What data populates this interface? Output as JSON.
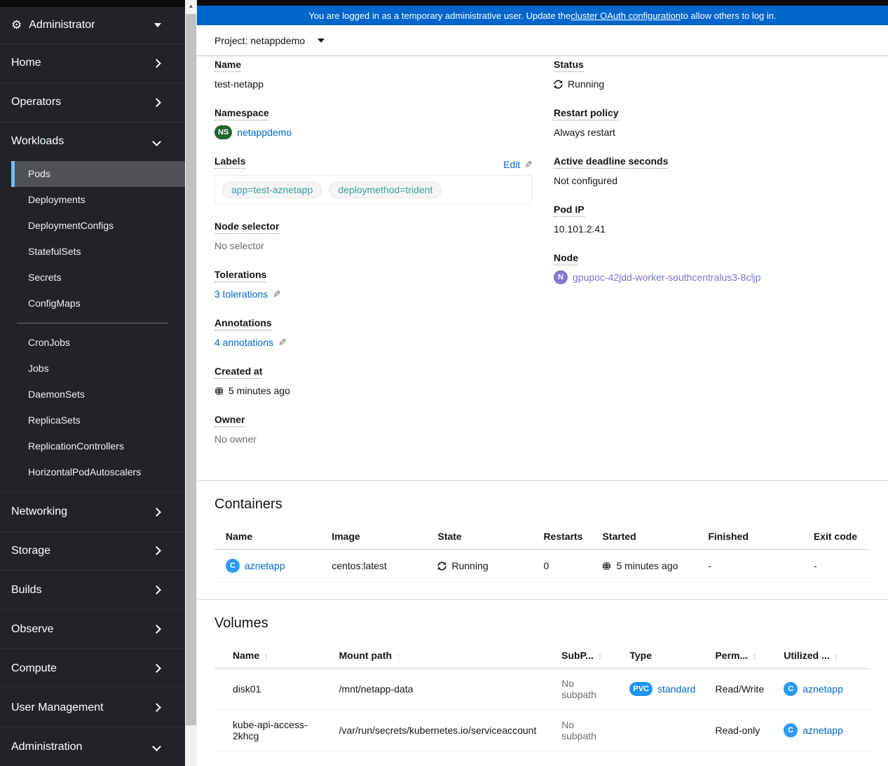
{
  "colors": {
    "banner_bg": "#0066cc",
    "link": "#0066cc",
    "sidebar_bg": "#212427",
    "sidebar_selected_bg": "#4f5255",
    "sidebar_selected_border": "#73bcf7",
    "ns_badge": "#1e642c",
    "container_badge": "#2b9af3",
    "node_badge": "#8476d1",
    "pvc_badge": "#2196f3",
    "chip_text": "#3a9c9b",
    "muted_text": "#6a6e73"
  },
  "banner": {
    "text_before": "You are logged in as a temporary administrative user. Update the ",
    "link": "cluster OAuth configuration",
    "text_after": " to allow others to log in."
  },
  "toolbar": {
    "project": "Project: netappdemo"
  },
  "sidebar": {
    "perspective": "Administrator",
    "top_items": [
      "Home",
      "Operators",
      "Workloads"
    ],
    "workloads_items": [
      "Pods",
      "Deployments",
      "DeploymentConfigs",
      "StatefulSets",
      "Secrets",
      "ConfigMaps",
      "CronJobs",
      "Jobs",
      "DaemonSets",
      "ReplicaSets",
      "ReplicationControllers",
      "HorizontalPodAutoscalers"
    ],
    "selected_item": "Pods",
    "bottom_items": [
      "Networking",
      "Storage",
      "Builds",
      "Observe",
      "Compute",
      "User Management",
      "Administration"
    ]
  },
  "details": {
    "name": {
      "label": "Name",
      "value": "test-netapp"
    },
    "namespace": {
      "label": "Namespace",
      "badge": "NS",
      "value": "netappdemo"
    },
    "labels": {
      "label": "Labels",
      "edit": "Edit",
      "chips": [
        "app=test-aznetapp",
        "deploymethod=trident"
      ]
    },
    "node_selector": {
      "label": "Node selector",
      "value": "No selector"
    },
    "tolerations": {
      "label": "Tolerations",
      "value": "3 tolerations"
    },
    "annotations": {
      "label": "Annotations",
      "value": "4 annotations"
    },
    "created_at": {
      "label": "Created at",
      "value": "5 minutes ago"
    },
    "owner": {
      "label": "Owner",
      "value": "No owner"
    },
    "status": {
      "label": "Status",
      "value": "Running"
    },
    "restart_policy": {
      "label": "Restart policy",
      "value": "Always restart"
    },
    "active_deadline": {
      "label": "Active deadline seconds",
      "value": "Not configured"
    },
    "pod_ip": {
      "label": "Pod IP",
      "value": "10.101.2.41"
    },
    "node": {
      "label": "Node",
      "badge": "N",
      "value": "gpupoc-42jdd-worker-southcentralus3-8cljp"
    }
  },
  "containers": {
    "title": "Containers",
    "headers": [
      "Name",
      "Image",
      "State",
      "Restarts",
      "Started",
      "Finished",
      "Exit code"
    ],
    "row": {
      "badge": "C",
      "name": "aznetapp",
      "image": "centos:latest",
      "state": "Running",
      "restarts": "0",
      "started": "5 minutes ago",
      "finished": "-",
      "exit_code": "-"
    }
  },
  "volumes": {
    "title": "Volumes",
    "headers": [
      {
        "label": "Name",
        "sortable": true
      },
      {
        "label": "Mount path",
        "sortable": true
      },
      {
        "label": "SubP...",
        "sortable": true
      },
      {
        "label": "Type",
        "sortable": false
      },
      {
        "label": "Perm...",
        "sortable": true
      },
      {
        "label": "Utilized ...",
        "sortable": true
      }
    ],
    "rows": [
      {
        "name": "disk01",
        "mount_path": "/mnt/netapp-data",
        "subpath": "No subpath",
        "type_badge": "PVC",
        "type_link": "standard",
        "permissions": "Read/Write",
        "utilized_badge": "C",
        "utilized": "aznetapp"
      },
      {
        "name": "kube-api-access-2khcg",
        "mount_path": "/var/run/secrets/kubernetes.io/serviceaccount",
        "subpath": "No subpath",
        "type_badge": "",
        "type_link": "",
        "permissions": "Read-only",
        "utilized_badge": "C",
        "utilized": "aznetapp"
      }
    ]
  }
}
